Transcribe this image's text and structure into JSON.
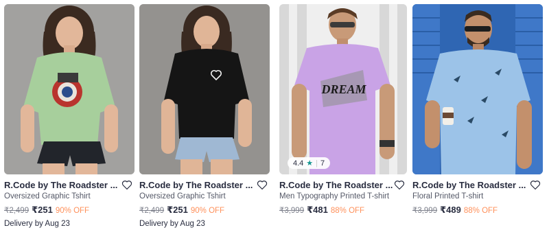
{
  "products": [
    {
      "brand": "R.Code by The Roadster ...",
      "name": "Oversized Graphic Tshirt",
      "mrp": "₹2,499",
      "price": "₹251",
      "discount": "90% OFF",
      "delivery": "Delivery by Aug 23",
      "image_icon": "woman-green-tshirt-image"
    },
    {
      "brand": "R.Code by The Roadster ...",
      "name": "Oversized Graphic Tshirt",
      "mrp": "₹2,499",
      "price": "₹251",
      "discount": "90% OFF",
      "delivery": "Delivery by Aug 23",
      "image_icon": "woman-black-tshirt-image"
    },
    {
      "brand": "R.Code by The Roadster ...",
      "name": "Men Typography Printed T-shirt",
      "mrp": "₹3,999",
      "price": "₹481",
      "discount": "88% OFF",
      "rating": "4.4",
      "rating_count": "7",
      "image_icon": "man-lavender-tshirt-image",
      "print_text": "DREAM"
    },
    {
      "brand": "R.Code by The Roadster ...",
      "name": "Floral Printed T-shirt",
      "mrp": "₹3,999",
      "price": "₹489",
      "discount": "88% OFF",
      "image_icon": "man-blue-floral-shirt-image"
    }
  ],
  "colors": {
    "discount": "#ff905a",
    "rating_star": "#14958f",
    "text_primary": "#282c3f",
    "text_muted": "#7e818c"
  }
}
